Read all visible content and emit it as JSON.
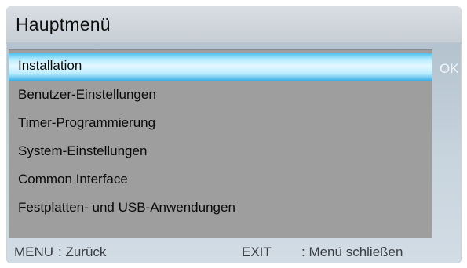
{
  "header": {
    "title": "Hauptmenü"
  },
  "menu": {
    "items": [
      {
        "label": "Installation",
        "selected": true
      },
      {
        "label": "Benutzer-Einstellungen",
        "selected": false
      },
      {
        "label": "Timer-Programmierung",
        "selected": false
      },
      {
        "label": "System-Einstellungen",
        "selected": false
      },
      {
        "label": "Common Interface",
        "selected": false
      },
      {
        "label": "Festplatten- und USB-Anwendungen",
        "selected": false
      }
    ],
    "ok_hint": "OK"
  },
  "footer": {
    "menu_key": "MENU",
    "menu_action": ": Zurück",
    "exit_key": "EXIT",
    "exit_action": ": Menü schließen"
  },
  "colors": {
    "highlight": "#7fd8f8",
    "panel": "#9e9e9e"
  }
}
